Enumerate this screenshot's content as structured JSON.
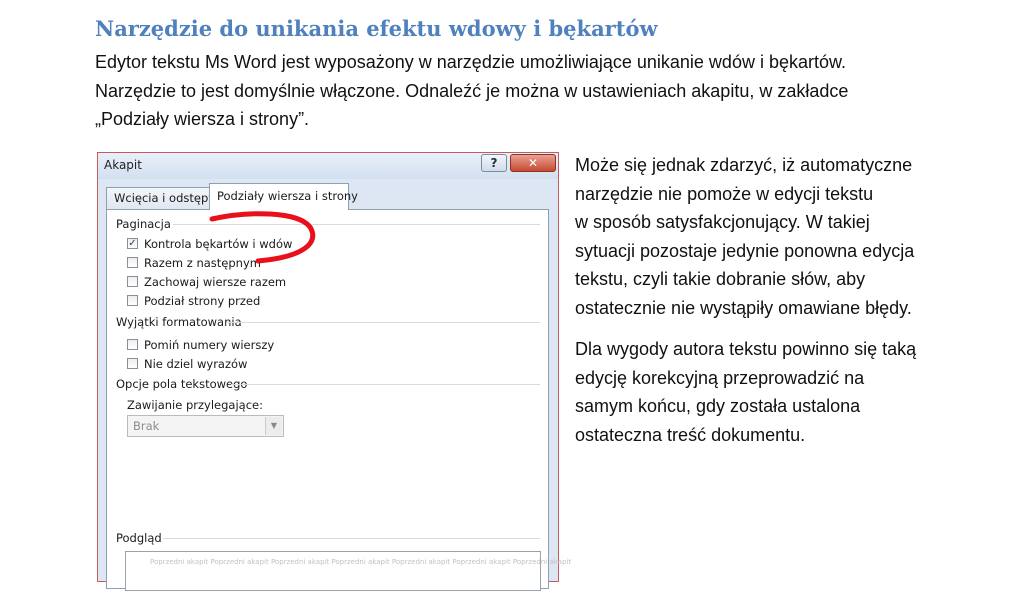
{
  "heading": "Narzędzie do unikania efektu wdowy i bękartów",
  "intro_lines": [
    "Edytor tekstu Ms Word jest wyposażony w narzędzie umożliwiające unikanie wdów i bękartów.",
    "Narzędzie to jest domyślnie włączone. Odnaleźć je można w ustawieniach akapitu, w zakładce",
    "„Podziały wiersza i strony”."
  ],
  "side_paragraphs": [
    {
      "lines": [
        "Może się jednak zdarzyć, iż automatyczne",
        "narzędzie nie pomoże w edycji tekstu",
        "w sposób satysfakcjonujący. W takiej",
        "sytuacji pozostaje jedynie ponowna edycja",
        "tekstu, czyli takie dobranie słów, aby",
        "ostatecznie nie wystąpiły omawiane błędy."
      ]
    },
    {
      "lines": [
        "Dla wygody autora tekstu powinno się taką",
        "edycję korekcyjną przeprowadzić na",
        "samym końcu, gdy została ustalona",
        "ostateczna treść dokumentu."
      ]
    }
  ],
  "dialog": {
    "title": "Akapit",
    "help_label": "?",
    "close_label": "✕",
    "tabs": [
      {
        "label": "Wcięcia i odstępy",
        "active": false
      },
      {
        "label": "Podziały wiersza i strony",
        "active": true
      }
    ],
    "pagination": {
      "label": "Paginacja",
      "items": [
        {
          "label": "Kontrola bękartów i wdów",
          "checked": true,
          "glyph": "✓"
        },
        {
          "label": "Razem z następnym",
          "checked": false,
          "glyph": ""
        },
        {
          "label": "Zachowaj wiersze razem",
          "checked": false,
          "glyph": ""
        },
        {
          "label": "Podział strony przed",
          "checked": false,
          "glyph": ""
        }
      ]
    },
    "exceptions": {
      "label": "Wyjątki formatowania",
      "items": [
        {
          "label": "Pomiń numery wierszy",
          "checked": false,
          "glyph": ""
        },
        {
          "label": "Nie dziel wyrazów",
          "checked": false,
          "glyph": ""
        }
      ]
    },
    "textbox_options": {
      "label": "Opcje pola tekstowego",
      "wrap_label": "Zawijanie przylegające:",
      "wrap_value": "Brak",
      "dropdown_arrow": "▼"
    },
    "preview": {
      "label": "Podgląd",
      "sample_text": "Poprzedni akapit Poprzedni akapit Poprzedni akapit Poprzedni akapit Poprzedni akapit Poprzedni akapit Poprzedni akapit"
    }
  },
  "colors": {
    "heading": "#4f81bd",
    "annotation": "#e8101a"
  }
}
